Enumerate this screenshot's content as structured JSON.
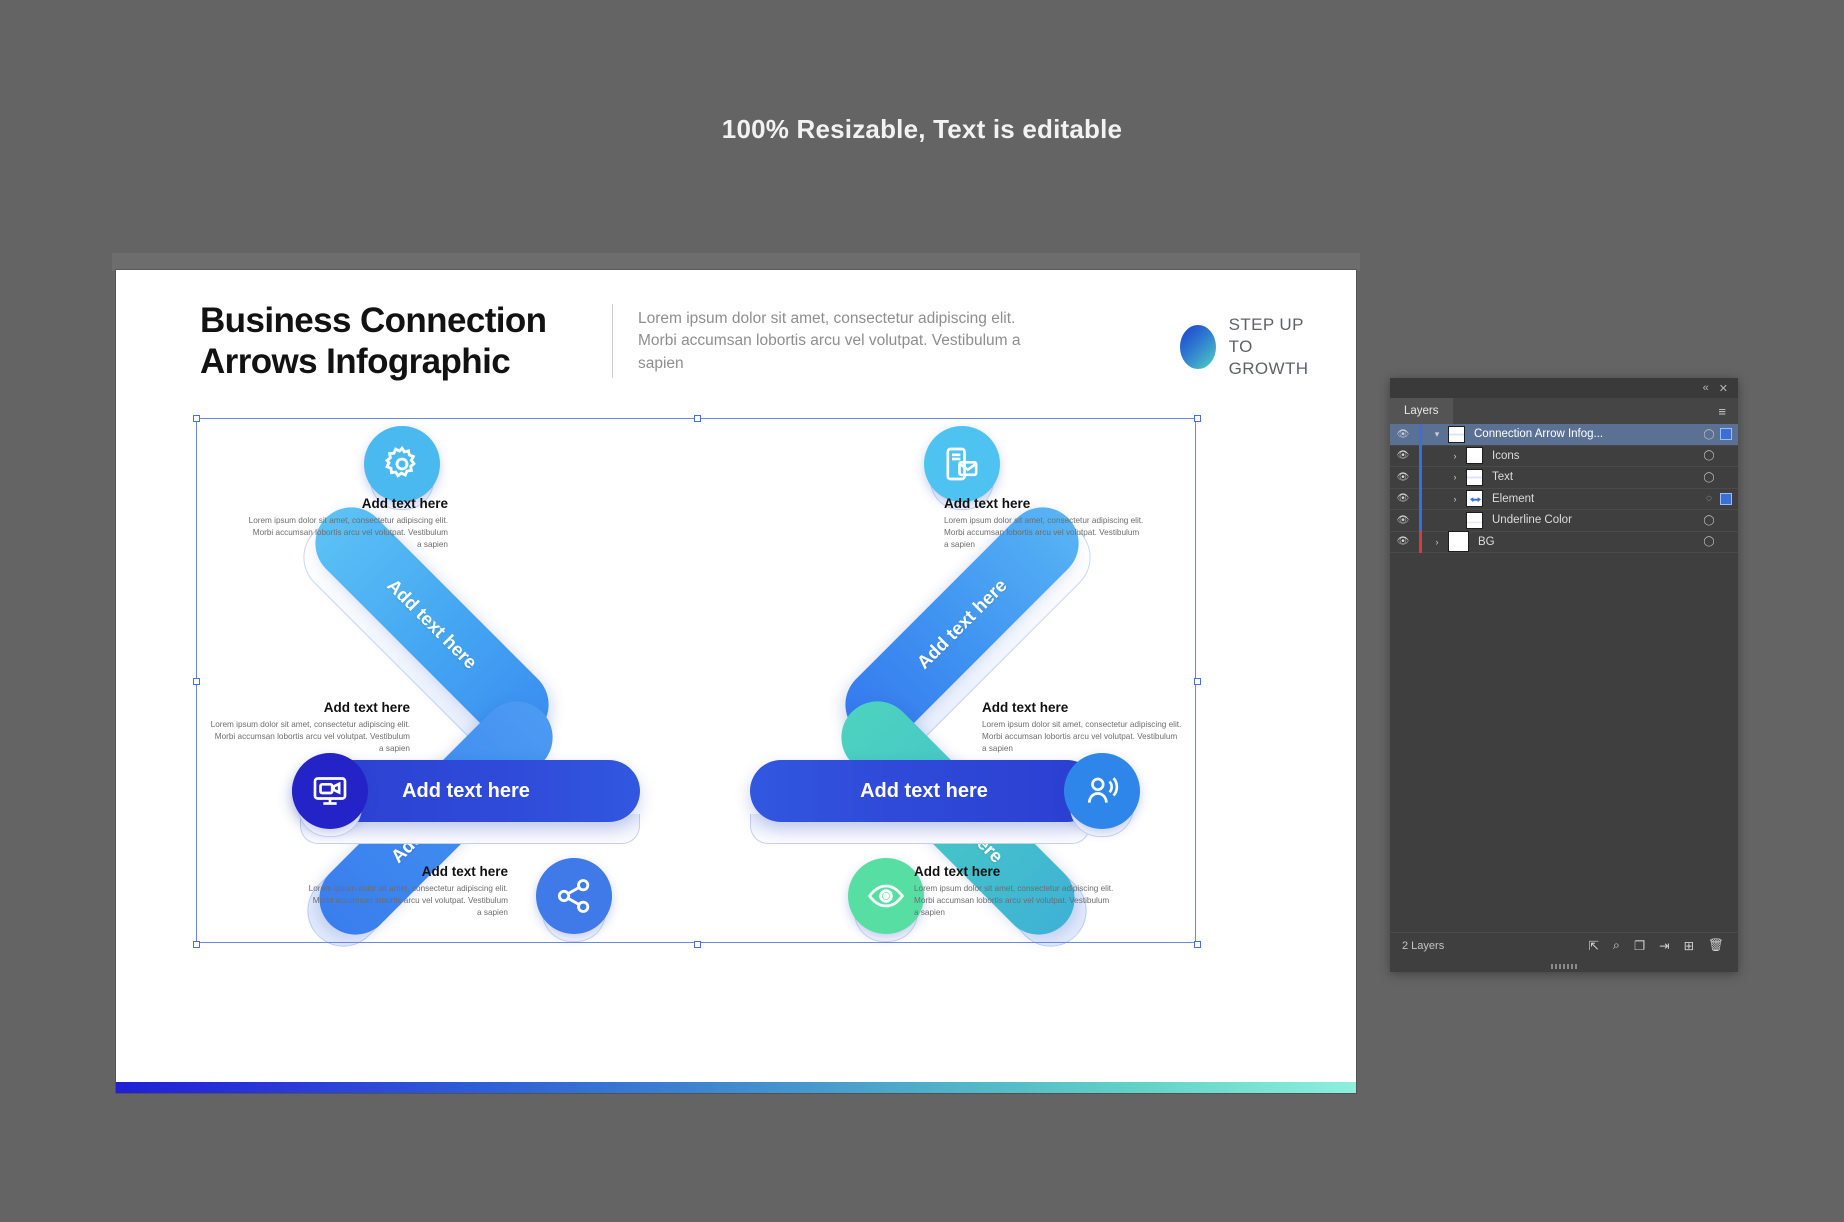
{
  "caption": {
    "text": "100% Resizable, Text is editable"
  },
  "header": {
    "title_line1": "Business Connection",
    "title_line2": "Arrows Infographic",
    "subtitle": "Lorem ipsum dolor sit amet, consectetur adipiscing elit. Morbi accumsan lobortis arcu vel volutpat. Vestibulum a sapien",
    "logo_line1": "STEP UP",
    "logo_line2": "TO GROWTH"
  },
  "infographic": {
    "arms": [
      {
        "label": "Add text here",
        "position": "top-left"
      },
      {
        "label": "Add text here",
        "position": "top-right"
      },
      {
        "label": "Add text here",
        "position": "bottom-left"
      },
      {
        "label": "Add text here",
        "position": "bottom-right"
      }
    ],
    "bars": [
      {
        "label": "Add text here",
        "position": "left"
      },
      {
        "label": "Add text here",
        "position": "right"
      }
    ],
    "captions": [
      {
        "title": "Add text here",
        "body": "Lorem ipsum dolor sit amet, consectetur adipiscing elit. Morbi accumsan lobortis arcu vel volutpat. Vestibulum a sapien",
        "position": "top-left"
      },
      {
        "title": "Add text here",
        "body": "Lorem ipsum dolor sit amet, consectetur adipiscing elit. Morbi accumsan lobortis arcu vel volutpat. Vestibulum a sapien",
        "position": "top-right"
      },
      {
        "title": "Add text here",
        "body": "Lorem ipsum dolor sit amet, consectetur adipiscing elit. Morbi accumsan lobortis arcu vel volutpat. Vestibulum a sapien",
        "position": "mid-left"
      },
      {
        "title": "Add text here",
        "body": "Lorem ipsum dolor sit amet, consectetur adipiscing elit. Morbi accumsan lobortis arcu vel volutpat. Vestibulum a sapien",
        "position": "mid-right"
      },
      {
        "title": "Add text here",
        "body": "Lorem ipsum dolor sit amet, consectetur adipiscing elit. Morbi accumsan lobortis arcu vel volutpat. Vestibulum a sapien",
        "position": "bottom-left"
      },
      {
        "title": "Add text here",
        "body": "Lorem ipsum dolor sit amet, consectetur adipiscing elit. Morbi accumsan lobortis arcu vel volutpat. Vestibulum a sapien",
        "position": "bottom-right"
      }
    ],
    "icons": [
      {
        "name": "gear-icon",
        "color": "#4ab9f0",
        "position": "top-left"
      },
      {
        "name": "mobile-email-icon",
        "color": "#4ec3f2",
        "position": "top-right"
      },
      {
        "name": "monitor-video-icon",
        "color": "#2323c8",
        "position": "mid-left"
      },
      {
        "name": "person-broadcast-icon",
        "color": "#2f86ea",
        "position": "mid-right"
      },
      {
        "name": "share-network-icon",
        "color": "#3f7ae8",
        "position": "bottom-left"
      },
      {
        "name": "eye-icon",
        "color": "#57dfa3",
        "position": "bottom-right"
      }
    ],
    "colors": {
      "arm_light": "#4fb6f2",
      "arm_blue": "#3b8ef0",
      "arm_teal": "#4fd3c2",
      "bar_dark": "#2b3fd2",
      "strip_start": "#1f1fd6",
      "strip_end": "#8df0dd"
    }
  },
  "layers_panel": {
    "tab_label": "Layers",
    "collapse_icon": "«",
    "close_icon": "✕",
    "menu_icon": "≡",
    "rows": [
      {
        "name": "Connection Arrow Infog...",
        "expanded": true,
        "selected": true,
        "has_swatch": true,
        "link_color": "#3b6fd8",
        "thumb": "pat"
      },
      {
        "name": "Icons",
        "expanded": false,
        "selected": false,
        "has_swatch": false,
        "link_color": "#3b6fd8",
        "thumb": "plain"
      },
      {
        "name": "Text",
        "expanded": false,
        "selected": false,
        "has_swatch": false,
        "link_color": "#3b6fd8",
        "thumb": "pat"
      },
      {
        "name": "Element",
        "expanded": false,
        "selected": false,
        "has_swatch": true,
        "link_color": "#3b6fd8",
        "thumb": "elem"
      },
      {
        "name": "Underline Color",
        "expanded": null,
        "selected": false,
        "has_swatch": false,
        "link_color": "#3b6fd8",
        "thumb": "under"
      },
      {
        "name": "BG",
        "expanded": false,
        "selected": false,
        "has_swatch": false,
        "link_color": "#d83b3b",
        "thumb": "plain"
      }
    ],
    "footer": {
      "count": "2 Layers",
      "icons": [
        "expand-icon",
        "search-icon",
        "duplicate-icon",
        "move-into-icon",
        "add-layer-icon",
        "delete-icon"
      ]
    }
  }
}
